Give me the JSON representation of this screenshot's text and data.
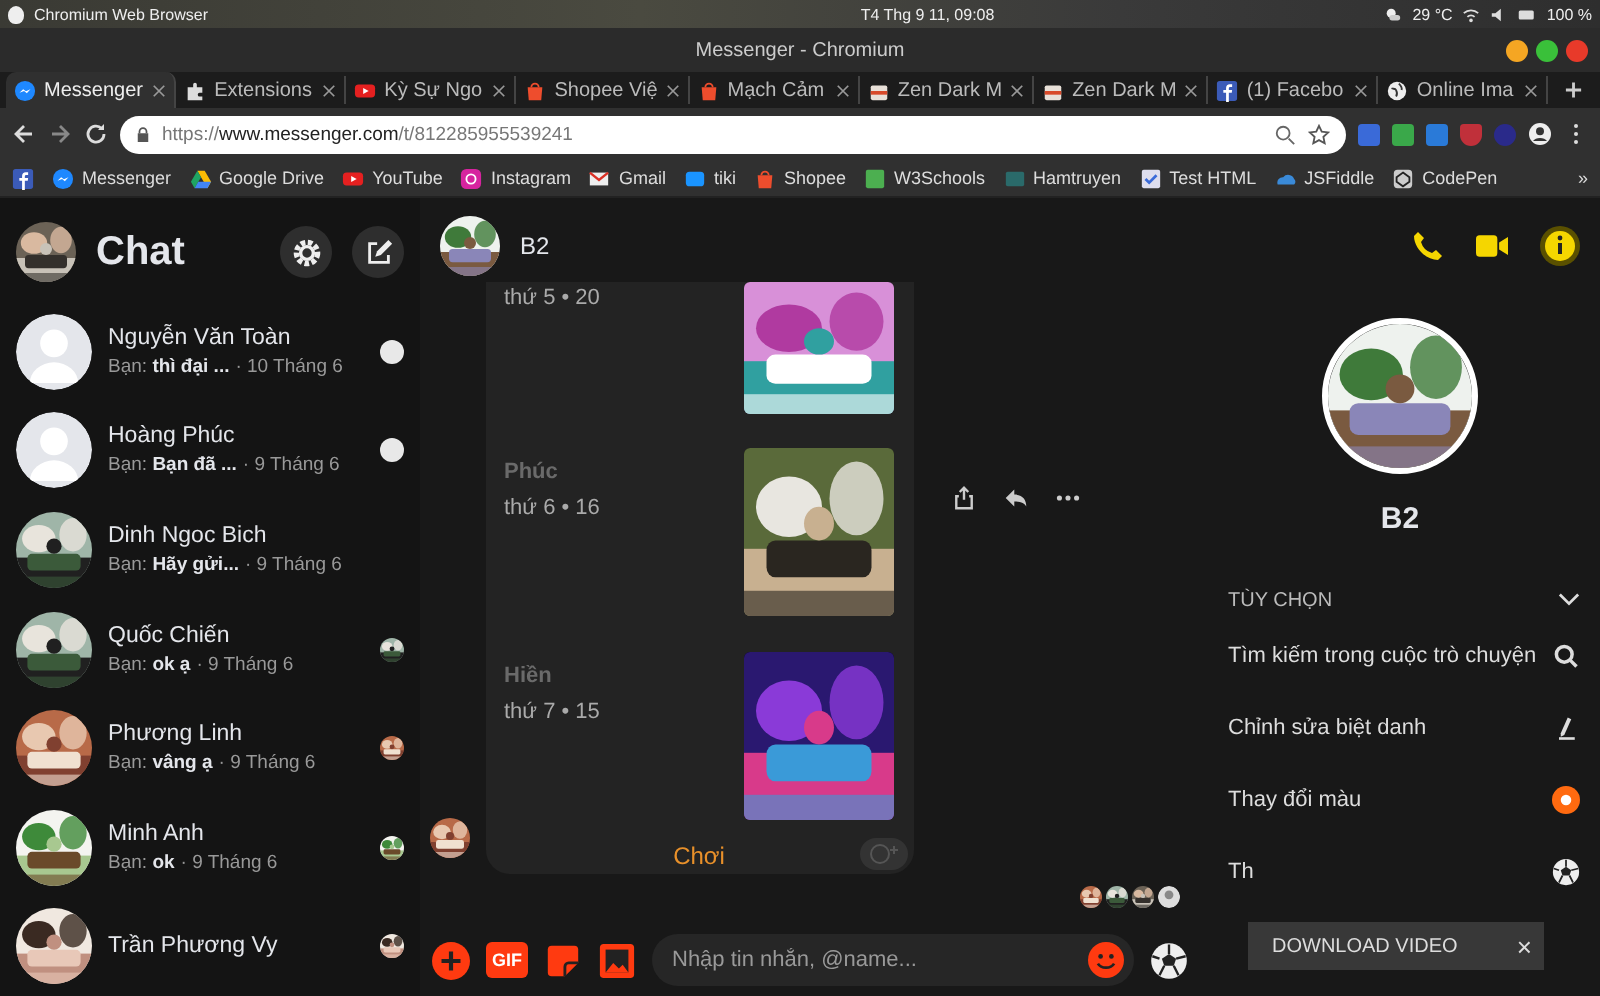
{
  "os_bar": {
    "app": "Chromium Web Browser",
    "clock": "T4 Thg 9 11, 09:08",
    "temperature": "29 °C",
    "battery": "100 %"
  },
  "window": {
    "title": "Messenger - Chromium"
  },
  "tabs": [
    {
      "label": "Messenger",
      "selected": true
    },
    {
      "label": "Extensions",
      "selected": false
    },
    {
      "label": "Kỳ Sự Ngo",
      "selected": false
    },
    {
      "label": "Shopee Việ",
      "selected": false
    },
    {
      "label": "Mạch Cảm",
      "selected": false
    },
    {
      "label": "Zen Dark M",
      "selected": false
    },
    {
      "label": "Zen Dark M",
      "selected": false
    },
    {
      "label": "(1) Facebo",
      "selected": false
    },
    {
      "label": "Online Ima",
      "selected": false
    }
  ],
  "address_bar": {
    "scheme": "https://",
    "host": "www.messenger.com",
    "path": "/t/812285955539241"
  },
  "bookmarks": [
    "Messenger",
    "Google Drive",
    "YouTube",
    "Instagram",
    "Gmail",
    "tiki",
    "Shopee",
    "W3Schools",
    "Hamtruyen",
    "Test HTML",
    "JSFiddle",
    "CodePen"
  ],
  "bookmarks_more": "»",
  "sidebar": {
    "title": "Chat",
    "conversations": [
      {
        "name": "Nguyễn Văn Toàn",
        "snippet": "Bạn: **thì đại ...**",
        "time": "· 10 Tháng 6"
      },
      {
        "name": "Hoàng Phúc",
        "snippet": "Bạn: **Bạn đã ...**",
        "time": "· 9 Tháng 6"
      },
      {
        "name": "Dinh Ngoc Bich",
        "snippet": "Bạn: **Hãy gửi...**",
        "time": "· 9 Tháng 6"
      },
      {
        "name": "Quốc Chiến",
        "snippet": "Bạn: **ok ạ**",
        "time": "· 9 Tháng 6"
      },
      {
        "name": "Phương Linh",
        "snippet": "Bạn: **vâng ạ**",
        "time": "· 9 Tháng 6"
      },
      {
        "name": "Minh Anh",
        "snippet": "Bạn: **ok**",
        "time": "· 9 Tháng 6"
      },
      {
        "name": "Trần Phương Vy"
      }
    ]
  },
  "conversation": {
    "title": "B2",
    "entries": [
      {
        "date": "thứ 5 • 20"
      },
      {
        "name": "Phúc",
        "date": "thứ 6 • 16"
      },
      {
        "name": "Hiền",
        "date": "thứ 7 • 15"
      }
    ],
    "play_button": "Chơi",
    "gif_button": "GIF",
    "composer": {
      "placeholder": "Nhập tin nhắn, @name..."
    }
  },
  "details": {
    "name": "B2",
    "section": "TÙY CHỌN",
    "options": [
      "Tìm kiếm trong cuộc trò chuyện",
      "Chỉnh sửa biệt danh",
      "Thay đổi màu",
      "Th"
    ]
  },
  "overlay": {
    "label": "DOWNLOAD VIDEO",
    "close": "×"
  }
}
